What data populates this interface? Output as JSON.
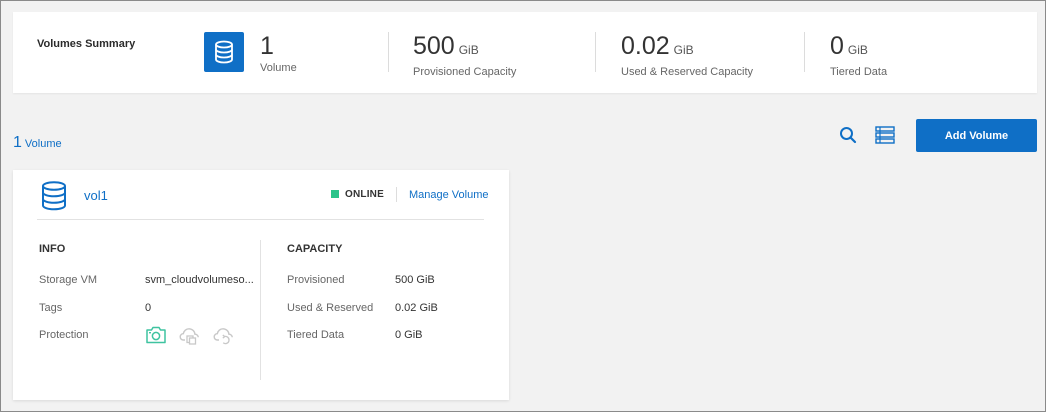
{
  "summary": {
    "title": "Volumes Summary",
    "icon": "database-icon",
    "stats": [
      {
        "value": "1",
        "unit": "",
        "label": "Volume"
      },
      {
        "value": "500",
        "unit": "GiB",
        "label": "Provisioned Capacity"
      },
      {
        "value": "0.02",
        "unit": "GiB",
        "label": "Used & Reserved Capacity"
      },
      {
        "value": "0",
        "unit": "GiB",
        "label": "Tiered Data"
      }
    ]
  },
  "toolbar": {
    "count": "1",
    "count_label": "Volume",
    "add_label": "Add Volume"
  },
  "card": {
    "name": "vol1",
    "status": "ONLINE",
    "manage_label": "Manage Volume",
    "info": {
      "title": "INFO",
      "storage_vm_label": "Storage VM",
      "storage_vm_value": "svm_cloudvolumeso...",
      "tags_label": "Tags",
      "tags_value": "0",
      "protection_label": "Protection"
    },
    "capacity": {
      "title": "CAPACITY",
      "provisioned_label": "Provisioned",
      "provisioned_value": "500 GiB",
      "used_label": "Used & Reserved",
      "used_value": "0.02 GiB",
      "tiered_label": "Tiered Data",
      "tiered_value": "0 GiB"
    }
  },
  "colors": {
    "accent": "#0f6fc6",
    "online": "#2bc48a",
    "protection_active": "#3fc3a0",
    "protection_inactive": "#c8c8c8"
  }
}
